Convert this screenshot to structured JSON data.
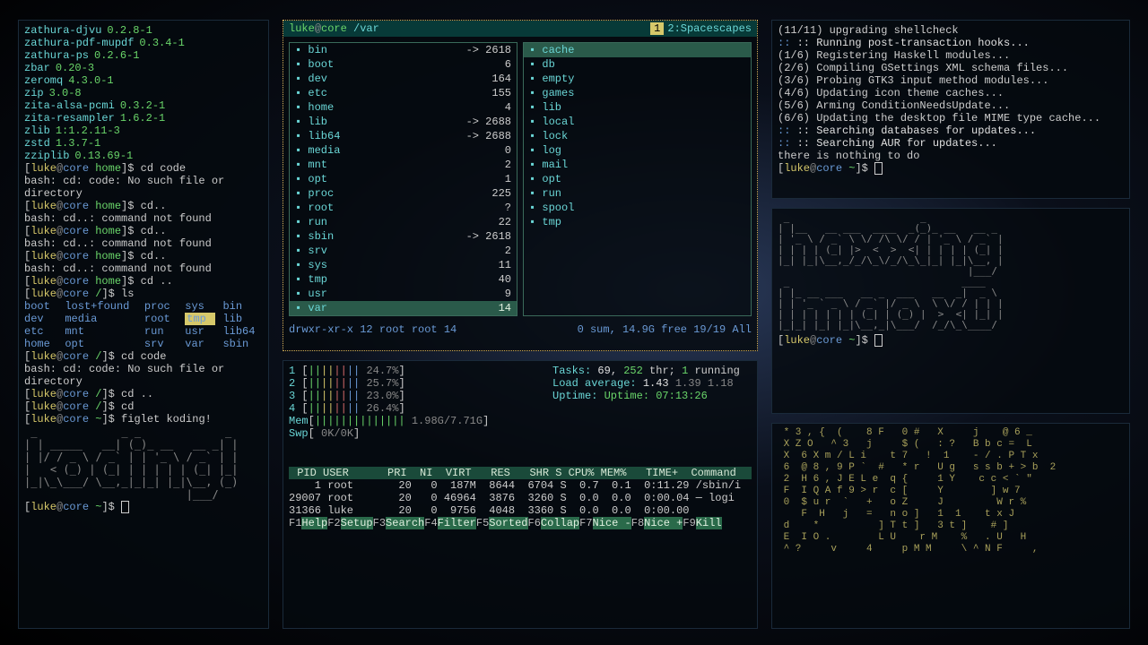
{
  "left": {
    "packages": [
      {
        "n": "zathura-djvu",
        "v": "0.2.8-1"
      },
      {
        "n": "zathura-pdf-mupdf",
        "v": "0.3.4-1"
      },
      {
        "n": "zathura-ps",
        "v": "0.2.6-1"
      },
      {
        "n": "zbar",
        "v": "0.20-3"
      },
      {
        "n": "zeromq",
        "v": "4.3.0-1"
      },
      {
        "n": "zip",
        "v": "3.0-8"
      },
      {
        "n": "zita-alsa-pcmi",
        "v": "0.3.2-1"
      },
      {
        "n": "zita-resampler",
        "v": "1.6.2-1"
      },
      {
        "n": "zlib",
        "v": "1:1.2.11-3"
      },
      {
        "n": "zstd",
        "v": "1.3.7-1"
      },
      {
        "n": "zziplib",
        "v": "0.13.69-1"
      }
    ],
    "cmds": [
      {
        "dir": "home",
        "cmd": "cd code",
        "err": "bash: cd: code: No such file or directory"
      },
      {
        "dir": "home",
        "cmd": "cd..",
        "err": "bash: cd..: command not found"
      },
      {
        "dir": "home",
        "cmd": "cd..",
        "err": "bash: cd..: command not found"
      },
      {
        "dir": "home",
        "cmd": "cd..",
        "err": "bash: cd..: command not found"
      },
      {
        "dir": "home",
        "cmd": "cd ..",
        "err": ""
      },
      {
        "dir": "/",
        "cmd": "ls",
        "err": ""
      }
    ],
    "ls": [
      "boot",
      "lost+found",
      "proc",
      "sys",
      "bin",
      "dev",
      "media",
      "root",
      "tmp",
      "lib",
      "etc",
      "mnt",
      "run",
      "usr",
      "lib64",
      "home",
      "opt",
      "srv",
      "var",
      "sbin"
    ],
    "cmds2": [
      {
        "dir": "/",
        "cmd": "cd code",
        "err": "bash: cd: code: No such file or directory"
      },
      {
        "dir": "/",
        "cmd": "cd ..",
        "err": ""
      },
      {
        "dir": "/",
        "cmd": "cd",
        "err": ""
      },
      {
        "dir": "~",
        "cmd": "figlet koding!",
        "err": ""
      }
    ],
    "figlet_koding": " _             _ _             _ \n| | _____   __| (_)_ __   __ _| |\n| |/ / _ \\ / _` | | '_ \\ / _` | |\n|   < (_) | (_| | | | | | (_| |_|\n|_|\\_\\___/ \\__,_|_|_| |_|\\__, (_)\n                         |___/   ",
    "prompt_final": {
      "user": "luke",
      "host": "core",
      "dir": "~"
    }
  },
  "ranger": {
    "user": "luke",
    "host": "core",
    "cwd": "/var",
    "tab1": "1",
    "tab2": "2:Spacescapes",
    "left_col": [
      {
        "n": "bin",
        "sz": "-> 2618",
        "sym": true
      },
      {
        "n": "boot",
        "sz": "6"
      },
      {
        "n": "dev",
        "sz": "164"
      },
      {
        "n": "etc",
        "sz": "155"
      },
      {
        "n": "home",
        "sz": "4"
      },
      {
        "n": "lib",
        "sz": "-> 2688",
        "sym": true
      },
      {
        "n": "lib64",
        "sz": "-> 2688",
        "sym": true
      },
      {
        "n": "media",
        "sz": "0"
      },
      {
        "n": "mnt",
        "sz": "2"
      },
      {
        "n": "opt",
        "sz": "1"
      },
      {
        "n": "proc",
        "sz": "225"
      },
      {
        "n": "root",
        "sz": "?"
      },
      {
        "n": "run",
        "sz": "22"
      },
      {
        "n": "sbin",
        "sz": "-> 2618",
        "sym": true
      },
      {
        "n": "srv",
        "sz": "2"
      },
      {
        "n": "sys",
        "sz": "11"
      },
      {
        "n": "tmp",
        "sz": "40"
      },
      {
        "n": "usr",
        "sz": "9"
      },
      {
        "n": "var",
        "sz": "14",
        "sel": true
      }
    ],
    "right_col": [
      {
        "n": "cache",
        "sel": true
      },
      {
        "n": "db"
      },
      {
        "n": "empty"
      },
      {
        "n": "games"
      },
      {
        "n": "lib"
      },
      {
        "n": "local"
      },
      {
        "n": "lock"
      },
      {
        "n": "log"
      },
      {
        "n": "mail"
      },
      {
        "n": "opt"
      },
      {
        "n": "run"
      },
      {
        "n": "spool"
      },
      {
        "n": "tmp"
      }
    ],
    "foot_perm": "drwxr-xr-x 12 root root 14",
    "foot_right": "0 sum, 14.9G free  19/19  All"
  },
  "htop": {
    "cpus": [
      {
        "id": "1",
        "pct": "24.7%"
      },
      {
        "id": "2",
        "pct": "25.7%"
      },
      {
        "id": "3",
        "pct": "23.0%"
      },
      {
        "id": "4",
        "pct": "26.4%"
      }
    ],
    "mem": "1.98G/7.71G",
    "swp": "0K/0K",
    "tasks": "Tasks: 69, 252 thr; 1 running",
    "load": "Load average: 1.43 1.39 1.18",
    "uptime": "Uptime: 07:13:26",
    "header": " PID USER      PRI  NI  VIRT   RES   SHR S CPU% MEM%   TIME+  Command",
    "rows": [
      "    1 root       20   0  187M  8644  6704 S  0.7  0.1  0:11.29 /sbin/i",
      "29007 root       20   0 46964  3876  3260 S  0.0  0.0  0:00.04 ─ logi",
      "31366 luke       20   0  9756  4048  3360 S  0.0  0.0  0:00.00        "
    ],
    "fkeys": [
      {
        "k": "F1",
        "l": "Help"
      },
      {
        "k": "F2",
        "l": "Setup"
      },
      {
        "k": "F3",
        "l": "Search"
      },
      {
        "k": "F4",
        "l": "Filter"
      },
      {
        "k": "F5",
        "l": "Sorted"
      },
      {
        "k": "F6",
        "l": "Collap"
      },
      {
        "k": "F7",
        "l": "Nice -"
      },
      {
        "k": "F8",
        "l": "Nice +"
      },
      {
        "k": "F9",
        "l": "Kill"
      }
    ]
  },
  "pacman": {
    "line1": "(11/11) upgrading shellcheck",
    "hooks": ":: Running post-transaction hooks...",
    "steps": [
      "(1/6) Registering Haskell modules...",
      "(2/6) Compiling GSettings XML schema files...",
      "(3/6) Probing GTK3 input method modules...",
      "(4/6) Updating icon theme caches...",
      "(5/6) Arming ConditionNeedsUpdate...",
      "(6/6) Updating the desktop file MIME type cache..."
    ],
    "search1": ":: Searching databases for updates...",
    "search2": ":: Searching AUR for updates...",
    "nothing": " there is nothing to do"
  },
  "figlet_big": " _                      _             \n| |__   __ ___  ____  _(_)_ __   __ _ \n| '_ \\ / _` \\ \\/ /\\ \\/ / | '_ \\ / _` |\n| | | | (_| |>  <  >  <| | | | | (_| |\n|_| |_|\\__,_/_/\\_\\/_/\\_\\_|_| |_|\\__, |\n                                |___/ \n _                             ____  \n| |_ __ ___   __ _  ___   __  _|  _ \\ \n| | '_ ` _ \\ / _` |/ _ \\  \\ \\/ / | | |\n| | | | | | | (_| | (_) |  >  <| |_| |\n|_|_| |_| |_|\\__,_|\\___/  /_/\\_\\____/ ",
  "matrix": [
    " * 3 , {  (    8 F   0 #   X     j    @ 6 _",
    " X Z O   ^ 3   j     $ (   : ?   B b c =  L",
    " X  6 X m / L i    t 7   !  1    - / . P T x",
    " 6  @ 8 , 9 P `  #   * r   U g   s s b + > b  2",
    " 2  H 6 , J E L e  q {     1 Y    c c < ` \"",
    " F  I Q A f 9 > r  c [     Y        ] w 7",
    " 0  $ u r  `   +   o Z     J         W r %",
    "    F  H   j   =   n o ]   1  1    t x J",
    " d    *          ] T t ]   3 t ]    # ]",
    " E  I O .        L U    r M    %   . U   H",
    " ^ ?     v     4     p M M     \\ ^ N F     ,"
  ]
}
